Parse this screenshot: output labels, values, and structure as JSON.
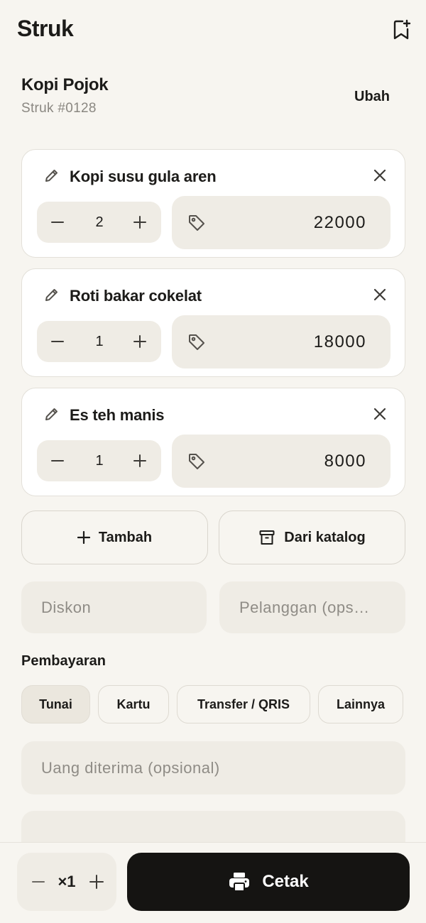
{
  "header": {
    "title": "Struk",
    "bookmark_icon": "bookmark-plus-icon"
  },
  "store": {
    "name": "Kopi Pojok",
    "receipt_number": "Struk #0128",
    "edit_label": "Ubah"
  },
  "items": [
    {
      "name": "Kopi susu gula aren",
      "quantity": "2",
      "price": "22000"
    },
    {
      "name": "Roti bakar cokelat",
      "quantity": "1",
      "price": "18000"
    },
    {
      "name": "Es teh manis",
      "quantity": "1",
      "price": "8000"
    }
  ],
  "actions": {
    "add_label": "Tambah",
    "catalog_label": "Dari katalog"
  },
  "inputs": {
    "discount_placeholder": "Diskon",
    "customer_placeholder": "Pelanggan (ops…",
    "received_placeholder": "Uang diterima (opsional)"
  },
  "payment": {
    "label": "Pembayaran",
    "methods": [
      "Tunai",
      "Kartu",
      "Transfer / QRIS",
      "Lainnya"
    ],
    "selected": "Tunai"
  },
  "footer": {
    "copies": "×1",
    "print_label": "Cetak"
  },
  "colors": {
    "background": "#f7f5f0",
    "field": "#efece5",
    "primary_button": "#151412"
  }
}
